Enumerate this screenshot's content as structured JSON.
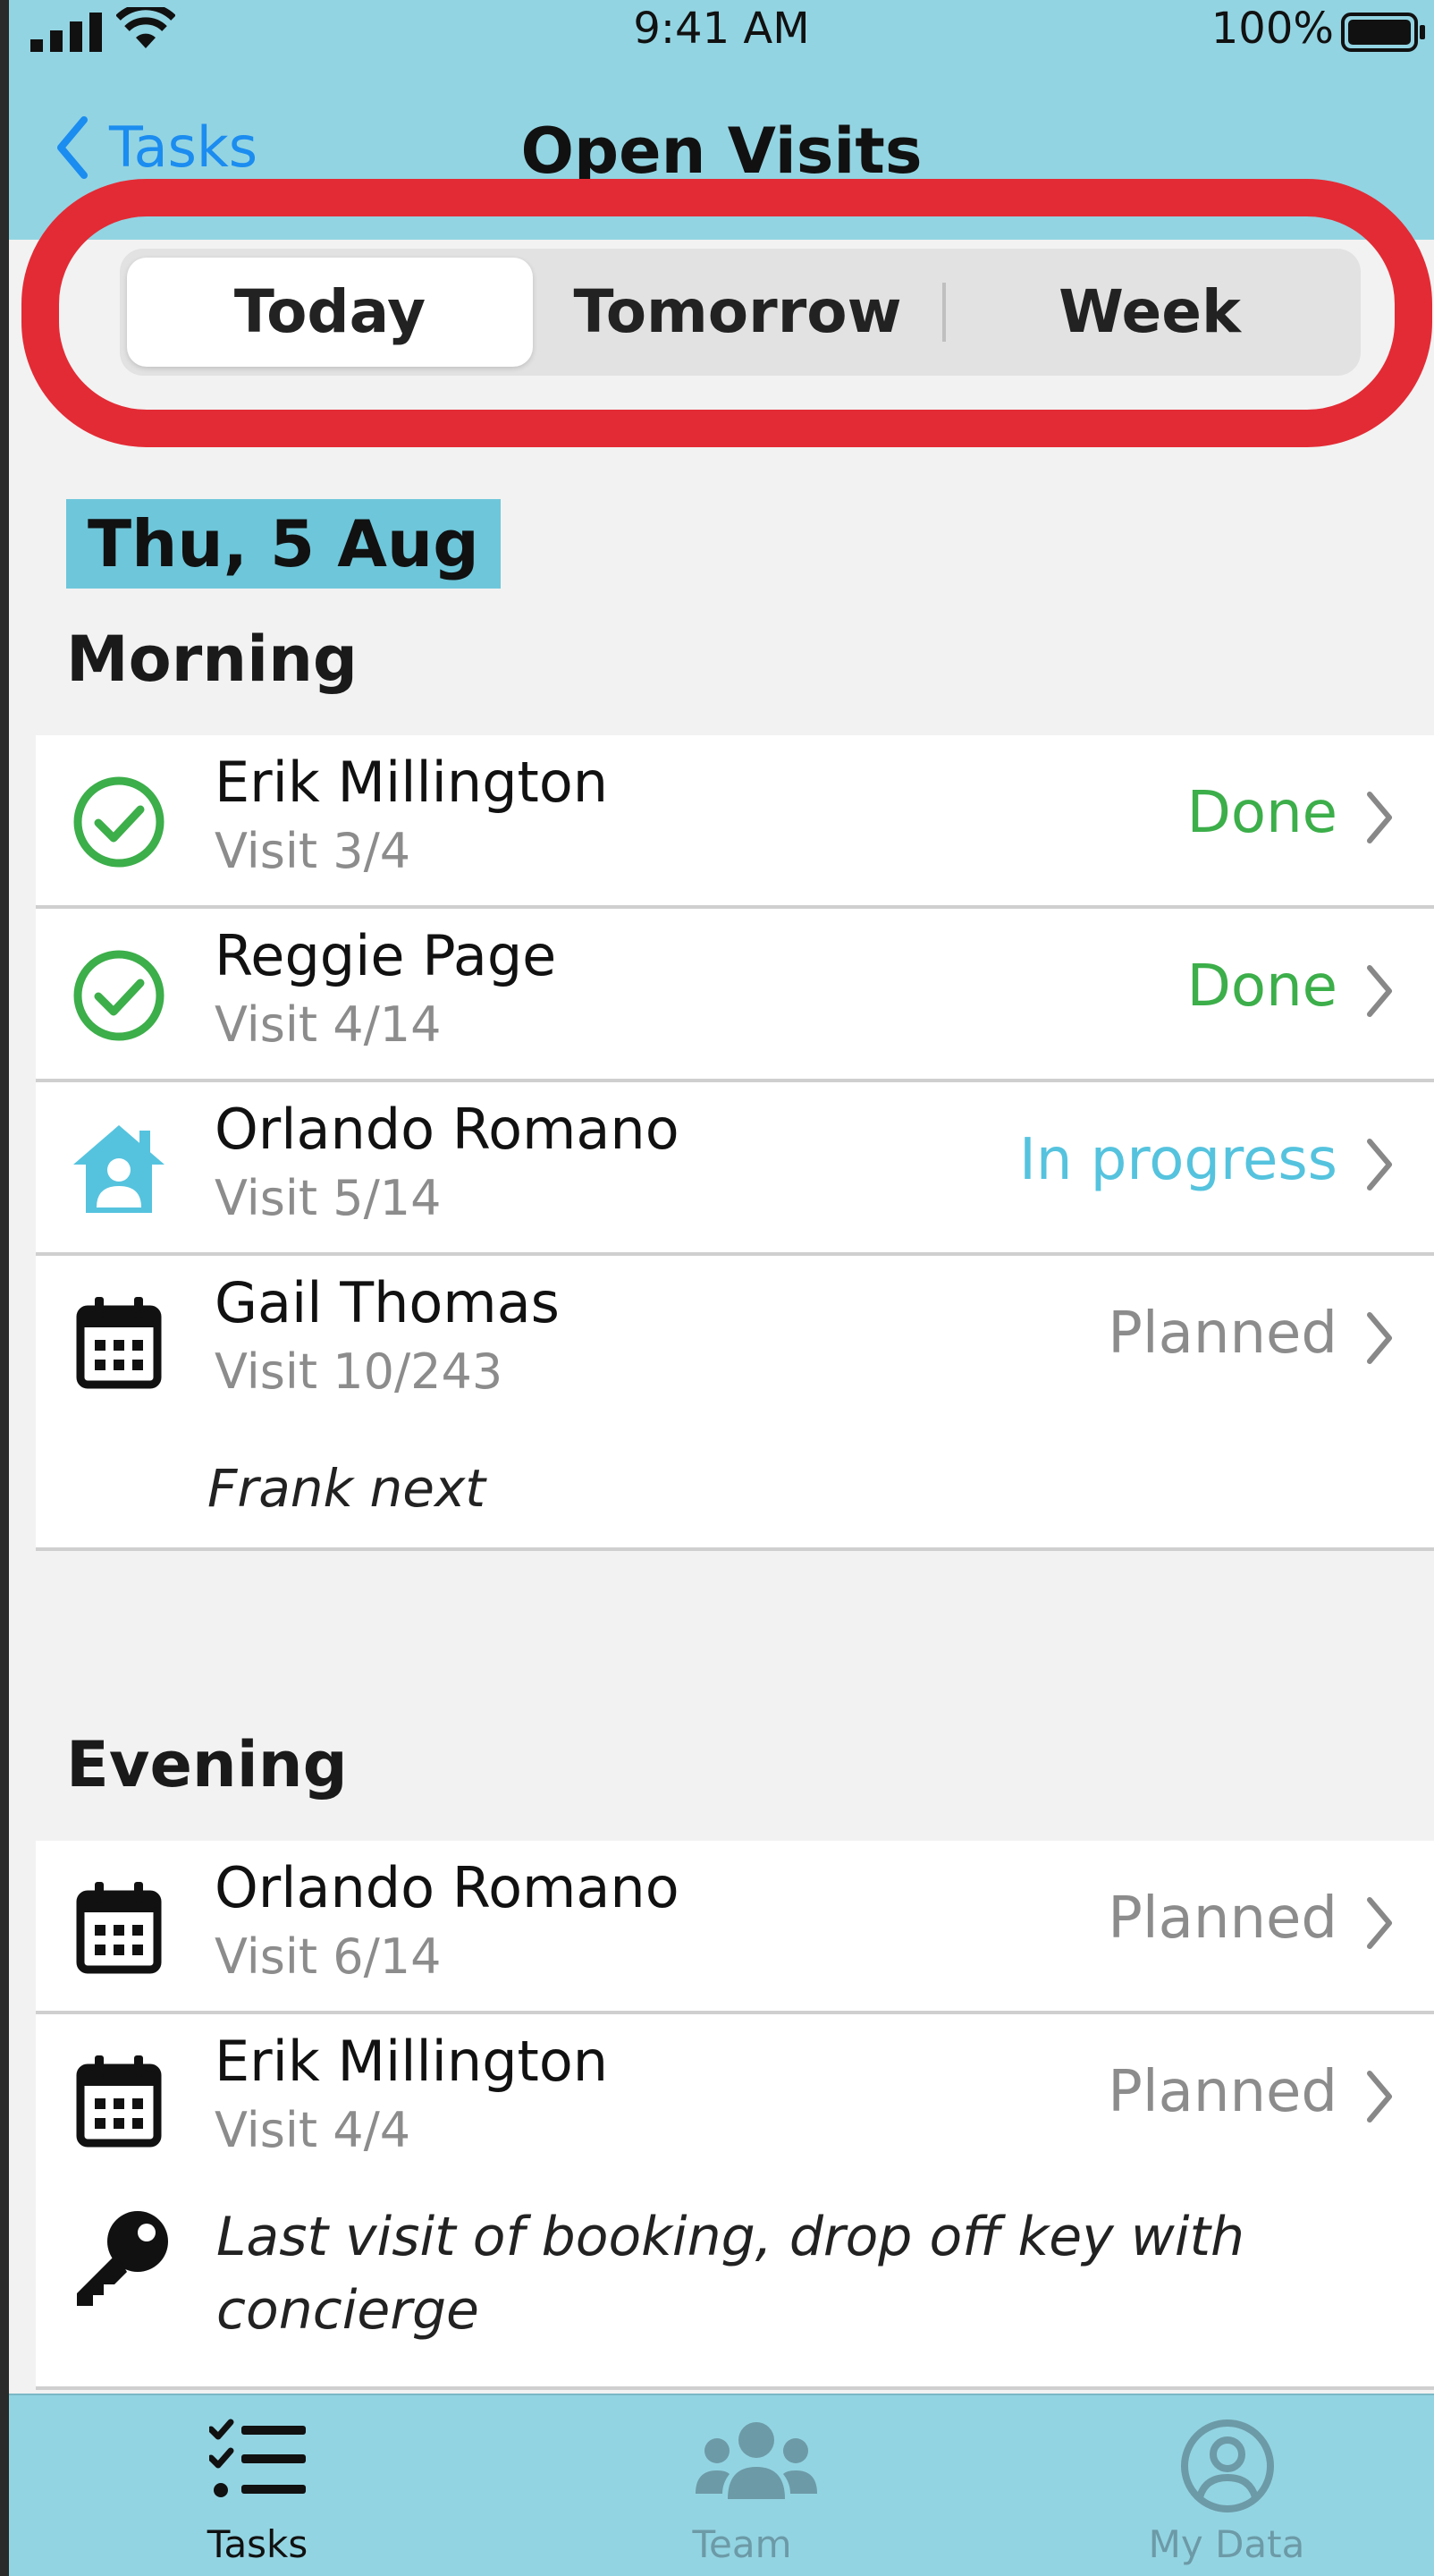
{
  "status_bar": {
    "time": "9:41 AM",
    "battery": "100%"
  },
  "nav": {
    "back_label": "Tasks",
    "title": "Open Visits"
  },
  "segments": [
    "Today",
    "Tomorrow",
    "Week"
  ],
  "selected_segment": "Today",
  "date_header": "Thu, 5 Aug",
  "sections": [
    {
      "title": "Morning",
      "visits": [
        {
          "name": "Erik Millington",
          "visit": "Visit 3/4",
          "status": "Done",
          "icon": "check-circle-icon"
        },
        {
          "name": "Reggie Page",
          "visit": "Visit 4/14",
          "status": "Done",
          "icon": "check-circle-icon"
        },
        {
          "name": "Orlando Romano",
          "visit": "Visit 5/14",
          "status": "In progress",
          "icon": "house-person-icon"
        },
        {
          "name": "Gail Thomas",
          "visit": "Visit 10/243",
          "status": "Planned",
          "icon": "calendar-icon",
          "note": "Frank next"
        }
      ]
    },
    {
      "title": "Evening",
      "visits": [
        {
          "name": "Orlando Romano",
          "visit": "Visit 6/14",
          "status": "Planned",
          "icon": "calendar-icon"
        },
        {
          "name": "Erik Millington",
          "visit": "Visit 4/4",
          "status": "Planned",
          "icon": "calendar-icon",
          "note": "Last visit of booking, drop off key with concierge",
          "note_icon": "key-icon"
        }
      ]
    }
  ],
  "tabs": [
    {
      "label": "Tasks",
      "icon": "tasks-list-icon",
      "active": true
    },
    {
      "label": "Team",
      "icon": "team-icon",
      "active": false
    },
    {
      "label": "My Data",
      "icon": "user-circle-icon",
      "active": false
    }
  ],
  "colors": {
    "header": "#93d4e2",
    "done": "#3cae4a",
    "in_progress": "#55c3de",
    "planned": "#8c8c8c",
    "link": "#1b8cf0",
    "annotation": "#e32b35"
  }
}
